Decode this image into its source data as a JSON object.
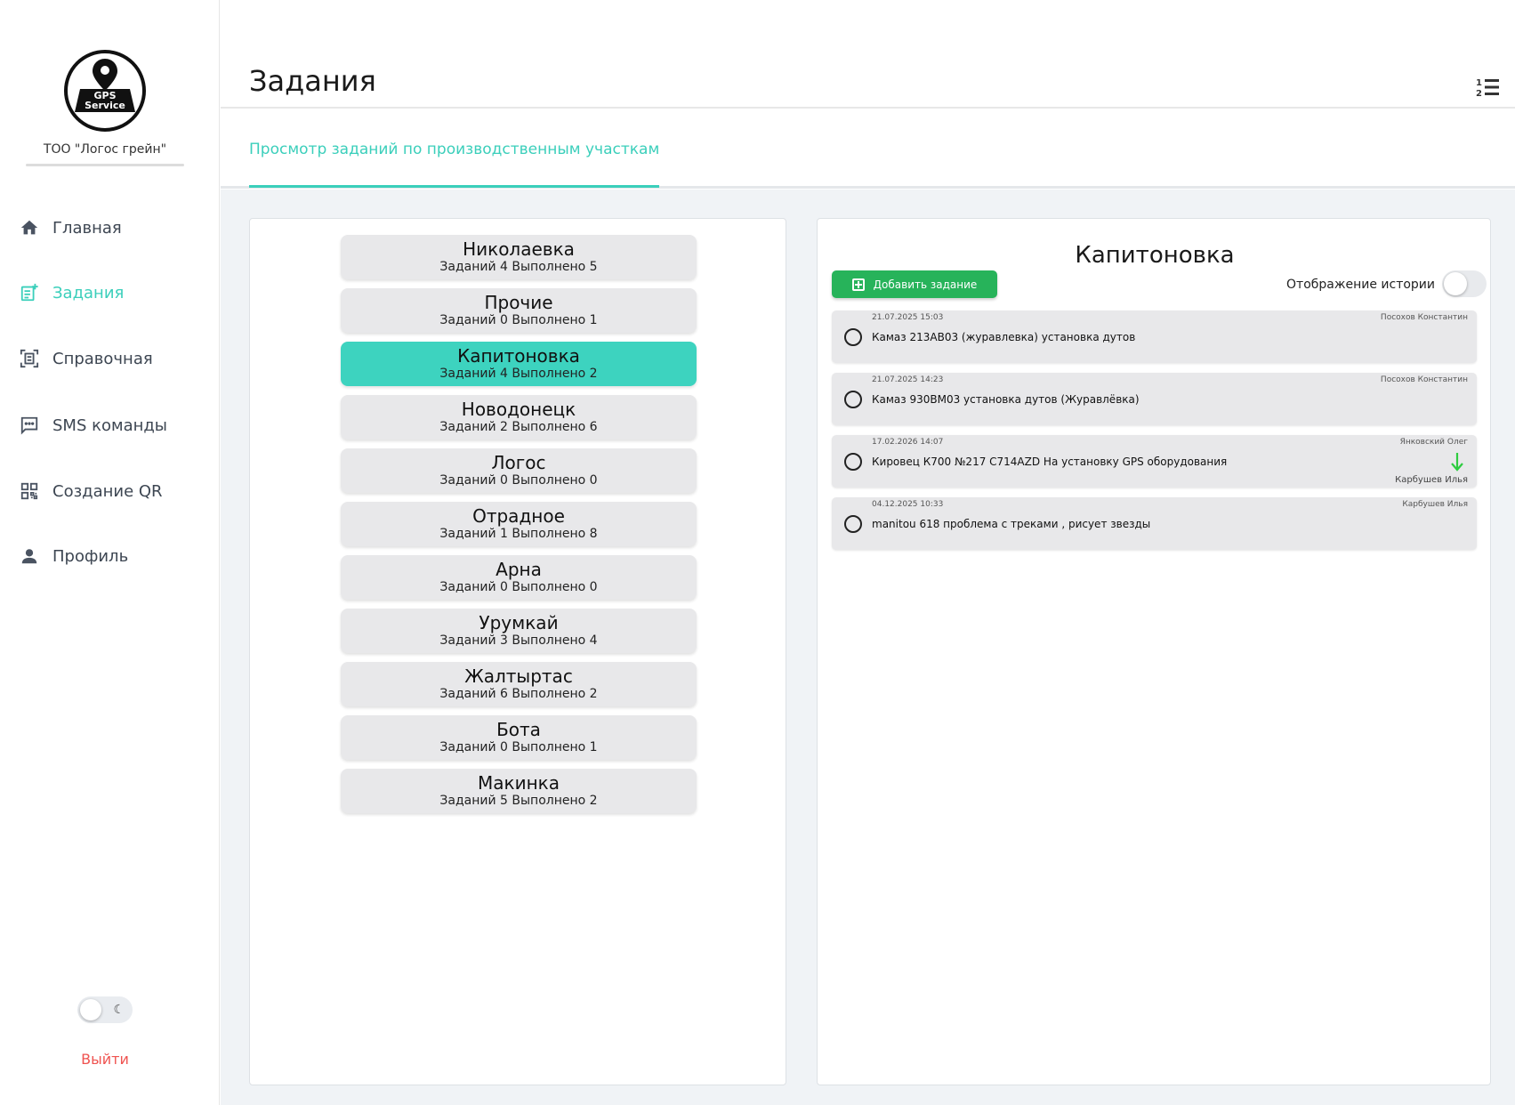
{
  "sidebar": {
    "logo_text": [
      "GPS",
      "Service"
    ],
    "company": "ТОО \"Логос грейн\"",
    "items": [
      {
        "label": "Главная",
        "icon": "home-icon",
        "active": false
      },
      {
        "label": "Задания",
        "icon": "task-add-icon",
        "active": true
      },
      {
        "label": "Справочная",
        "icon": "reference-icon",
        "active": false
      },
      {
        "label": "SMS команды",
        "icon": "sms-icon",
        "active": false
      },
      {
        "label": "Создание QR",
        "icon": "qr-icon",
        "active": false
      },
      {
        "label": "Профиль",
        "icon": "profile-icon",
        "active": false
      }
    ],
    "logout": "Выйти"
  },
  "header": {
    "title": "Задания",
    "tab": "Просмотр заданий по производственным участкам"
  },
  "locations": [
    {
      "name": "Николаевка",
      "stats": "Заданий 4 Выполнено 5",
      "active": false
    },
    {
      "name": "Прочие",
      "stats": "Заданий 0 Выполнено 1",
      "active": false
    },
    {
      "name": "Капитоновка",
      "stats": "Заданий 4 Выполнено 2",
      "active": true
    },
    {
      "name": "Новодонецк",
      "stats": "Заданий 2 Выполнено 6",
      "active": false
    },
    {
      "name": "Логос",
      "stats": "Заданий 0 Выполнено 0",
      "active": false
    },
    {
      "name": "Отрадное",
      "stats": "Заданий 1 Выполнено 8",
      "active": false
    },
    {
      "name": "Арна",
      "stats": "Заданий 0 Выполнено 0",
      "active": false
    },
    {
      "name": "Урумкай",
      "stats": "Заданий 3 Выполнено 4",
      "active": false
    },
    {
      "name": "Жалтыртас",
      "stats": "Заданий 6 Выполнено 2",
      "active": false
    },
    {
      "name": "Бота",
      "stats": "Заданий 0 Выполнено 1",
      "active": false
    },
    {
      "name": "Макинка",
      "stats": "Заданий 5 Выполнено 2",
      "active": false
    }
  ],
  "detail": {
    "title": "Капитоновка",
    "add_button": "Добавить задание",
    "history_label": "Отображение истории",
    "tasks": [
      {
        "date": "21.07.2025 15:03",
        "author": "Посохов Константин",
        "text": "Камаз 213АВ03 (журавлевка) установка дутов",
        "assignee": ""
      },
      {
        "date": "21.07.2025 14:23",
        "author": "Посохов Константин",
        "text": "Камаз 930ВМ03 установка дутов (Журавлёвка)",
        "assignee": ""
      },
      {
        "date": "17.02.2026 14:07",
        "author": "Янковский Олег",
        "text": "Кировец К700 №217 C714AZD  На установку GPS оборудования",
        "assignee": "Карбушев Илья"
      },
      {
        "date": "04.12.2025 10:33",
        "author": "Карбушев Илья",
        "text": "manitou 618 проблема с треками , рисует звезды",
        "assignee": ""
      }
    ]
  },
  "colors": {
    "accent": "#3bcfbb",
    "active_location": "#3dd3bf",
    "add_button": "#27b35a",
    "logout": "#ef5350"
  }
}
